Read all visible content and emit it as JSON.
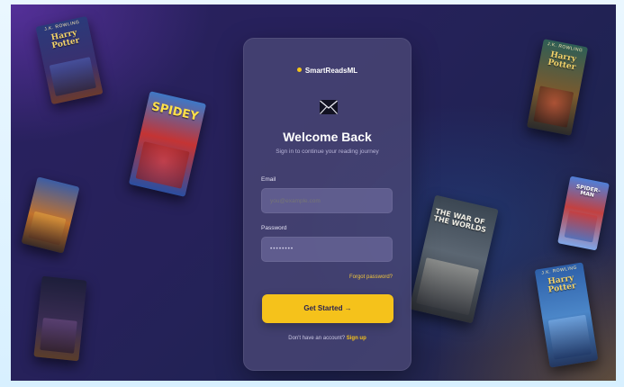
{
  "brand": {
    "name": "SmartReadsML"
  },
  "login": {
    "title": "Welcome Back",
    "subtitle": "Sign in to continue your reading journey",
    "email_label": "Email",
    "email_placeholder": "you@example.com",
    "password_label": "Password",
    "password_value": "••••••••",
    "forgot_label": "Forgot password?",
    "submit_label": "Get Started →",
    "signup_prompt": "Don't have an account?",
    "signup_link": "Sign up"
  },
  "books": [
    {
      "author": "J.K. ROWLING",
      "title": "Harry Potter"
    },
    {
      "author": "",
      "title": "SPIDEY"
    },
    {
      "author": "",
      "title": ""
    },
    {
      "author": "",
      "title": ""
    },
    {
      "author": "",
      "title": "THE WAR OF THE WORLDS"
    },
    {
      "author": "J.K. ROWLING",
      "title": "Harry Potter"
    },
    {
      "author": "",
      "title": "SPIDER-MAN"
    },
    {
      "author": "J.K. ROWLING",
      "title": "Harry Potter"
    }
  ],
  "colors": {
    "accent": "#f5c21b",
    "card": "#4a4876",
    "background": "#26215a"
  },
  "icons": {
    "brand": "brand-dot-icon",
    "mail": "mail-icon"
  }
}
